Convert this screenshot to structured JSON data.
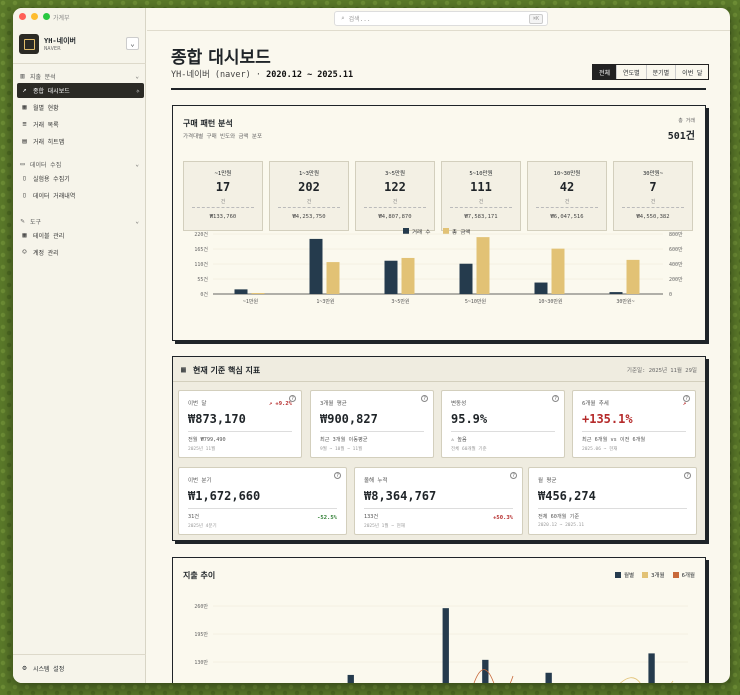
{
  "app": {
    "title": "가계부",
    "brand_name": "YH-네이버",
    "brand_sub": "NAVER"
  },
  "sidebar": {
    "sections": [
      {
        "title": "지출 분석",
        "items": [
          {
            "label": "종합 대시보드",
            "active": true
          },
          {
            "label": "월별 현황"
          },
          {
            "label": "거래 목록"
          },
          {
            "label": "거래 히트맵"
          }
        ]
      },
      {
        "title": "데이터 수집",
        "items": [
          {
            "label": "실험용 수집기"
          },
          {
            "label": "데이터 거래내역"
          }
        ]
      },
      {
        "title": "도구",
        "items": [
          {
            "label": "테이블 관리"
          },
          {
            "label": "계정 관리"
          }
        ]
      }
    ],
    "settings": "시스템 설정"
  },
  "search": {
    "placeholder": "검색...",
    "shortcut": "⌘K"
  },
  "page": {
    "title": "종합 대시보드",
    "subtitle_prefix": "YH-네이버 (naver) ·",
    "subtitle_range": "2020.12 ~ 2025.11"
  },
  "tabs": [
    "전체",
    "연도별",
    "분기별",
    "이번 달"
  ],
  "pattern": {
    "title": "구매 패턴 분석",
    "desc": "가격대별 구매 빈도와 금액 분포",
    "total_label": "총 거래",
    "total_value": "501건",
    "buckets": [
      {
        "label": "~1만원",
        "count": "17",
        "unit": "건",
        "amount": "₩133,760"
      },
      {
        "label": "1~3만원",
        "count": "202",
        "unit": "건",
        "amount": "₩4,253,750"
      },
      {
        "label": "3~5만원",
        "count": "122",
        "unit": "건",
        "amount": "₩4,807,870"
      },
      {
        "label": "5~10만원",
        "count": "111",
        "unit": "건",
        "amount": "₩7,583,171"
      },
      {
        "label": "10~30만원",
        "count": "42",
        "unit": "건",
        "amount": "₩6,047,516"
      },
      {
        "label": "30만원~",
        "count": "7",
        "unit": "건",
        "amount": "₩4,550,382"
      }
    ]
  },
  "chart_data": [
    {
      "type": "bar",
      "categories": [
        "~1만원",
        "1~3만원",
        "3~5만원",
        "5~10만원",
        "10~30만원",
        "30만원~"
      ],
      "series": [
        {
          "name": "거래 수",
          "axis": "left",
          "values": [
            17,
            202,
            122,
            111,
            42,
            7
          ],
          "color": "#253b4d"
        },
        {
          "name": "총 금액",
          "axis": "right",
          "values": [
            133760,
            4253750,
            4807870,
            7583171,
            6047516,
            4550382
          ],
          "color": "#e2c275"
        }
      ],
      "yticks_left": [
        "0건",
        "55건",
        "110건",
        "165건",
        "220건"
      ],
      "ylim_left": [
        0,
        220
      ],
      "yticks_right": [
        "0",
        "200만",
        "400만",
        "600만",
        "800만"
      ],
      "ylim_right": [
        0,
        8000000
      ],
      "legend": "top-center"
    },
    {
      "type": "bar",
      "title": "지출 추이",
      "series_names": [
        "월별",
        "3개월",
        "6개월"
      ],
      "colors": [
        "#253b4d",
        "#e2c275",
        "#c8693a"
      ],
      "yticks": [
        "260만",
        "195만",
        "130만"
      ],
      "values": [
        0,
        0,
        0,
        0,
        0,
        0,
        0,
        0,
        0,
        0,
        0,
        0,
        0,
        0,
        0,
        0,
        0,
        0,
        0,
        0,
        0,
        0,
        0,
        0,
        0,
        0,
        0,
        0,
        0,
        0,
        0,
        0,
        0,
        0,
        0,
        0,
        0,
        0,
        0,
        0,
        0,
        0,
        0,
        0,
        0,
        0,
        0,
        0,
        0,
        0,
        0,
        0,
        0,
        0,
        0,
        0,
        0,
        0,
        0,
        0
      ],
      "sample_bars": [
        {
          "i": 17,
          "v": 100
        },
        {
          "i": 29,
          "v": 255
        },
        {
          "i": 34,
          "v": 135
        },
        {
          "i": 42,
          "v": 105
        },
        {
          "i": 46,
          "v": 80
        },
        {
          "i": 55,
          "v": 150
        }
      ]
    }
  ],
  "metrics": {
    "title": "현재 기준 핵심 지표",
    "date": "기준일: 2025년 11월 29일",
    "cards": [
      {
        "label": "이번 달",
        "value": "₩873,170",
        "badge": "↗ +9.2%",
        "badge_color": "#b52a2a",
        "sub1": "전월 ₩799,490",
        "sub2": "2025년 11월"
      },
      {
        "label": "3개월 평균",
        "value": "₩900,827",
        "sub1": "최근 3개월 이동평균",
        "sub2": "9월 ~ 10월 ~ 11월"
      },
      {
        "label": "변동성",
        "value": "95.9%",
        "sub1": "⚠ 높음",
        "sub2": "전체 60개월 기준"
      },
      {
        "label": "6개월 추세",
        "value": "+135.1%",
        "value_color": "#b52a2a",
        "badge": "↗",
        "badge_color": "#b52a2a",
        "sub1": "최근 6개월 vs 이전 6개월",
        "sub2": "2025.06 ~ 현재"
      },
      {
        "label": "이번 분기",
        "value": "₩1,672,660",
        "sub1": "31건",
        "right": "-52.5%",
        "right_color": "#2e7d32",
        "sub2": "2025년 4분기"
      },
      {
        "label": "올해 누적",
        "value": "₩8,364,767",
        "sub1": "133건",
        "right": "+50.3%",
        "right_color": "#b52a2a",
        "sub2": "2025년 1월 ~ 현재"
      },
      {
        "label": "월 평균",
        "value": "₩456,274",
        "sub1": "전체 60개월 기준",
        "sub2": "2020.12 ~ 2025.11"
      }
    ]
  },
  "trend": {
    "title": "지출 추이"
  }
}
